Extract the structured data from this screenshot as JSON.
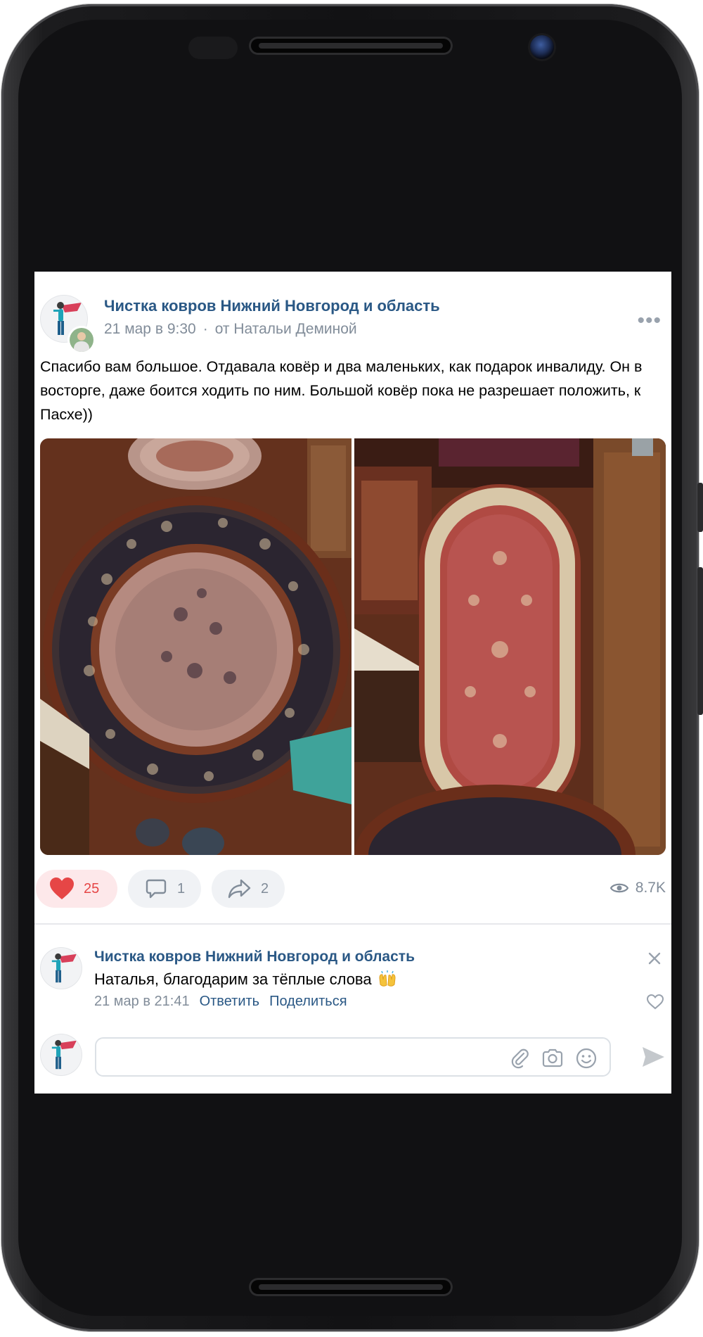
{
  "post": {
    "author": "Чистка ковров Нижний Новгород и область",
    "date": "21 мар в 9:30",
    "separator": "·",
    "from": "от Натальи Деминой",
    "more_label": "•••",
    "text": "Спасибо вам большое. Отдавала ковёр и два маленьких, как подарок инвалиду. Он в восторге, даже боится ходить по ним. Большой ковёр пока не разрешает положить, к Пасхе))",
    "photos": [
      "round-carpet-photo",
      "oval-carpet-photo"
    ]
  },
  "actions": {
    "likes": "25",
    "comments": "1",
    "shares": "2",
    "views": "8.7K"
  },
  "comment": {
    "author": "Чистка ковров Нижний Новгород и область",
    "text": "Наталья, благодарим за тёплые слова",
    "emoji": "raising-hands-emoji",
    "date": "21 мар в 21:41",
    "reply_label": "Ответить",
    "share_label": "Поделиться"
  },
  "comment_input": {
    "placeholder": "",
    "icons": [
      "paperclip-icon",
      "camera-icon",
      "smile-icon",
      "send-icon"
    ]
  },
  "colors": {
    "link": "#2a5885",
    "secondary": "#818c99",
    "like": "#e64646",
    "like_bg": "#fde8ea",
    "pill_bg": "#f0f2f5"
  }
}
